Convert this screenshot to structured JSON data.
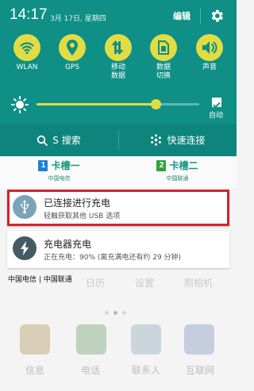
{
  "status_bar": {
    "time": "14:17",
    "date": "3月 17日, 星期四",
    "edit_label": "编辑",
    "settings_icon": "gear-icon"
  },
  "quick_settings": [
    {
      "label": "WLAN",
      "icon": "wifi-icon"
    },
    {
      "label": "GPS",
      "icon": "location-pin-icon"
    },
    {
      "label": "移动\n数据",
      "icon": "mobile-data-icon"
    },
    {
      "label": "数据\n切换",
      "icon": "sim-switch-icon"
    },
    {
      "label": "声音",
      "icon": "speaker-icon"
    }
  ],
  "brightness": {
    "level": 0.73,
    "auto_label": "自动",
    "auto_checked": true
  },
  "actions": {
    "search_label": "S 搜索",
    "quick_connect_label": "快速连接"
  },
  "sim": [
    {
      "number": "1",
      "name": "卡槽一",
      "carrier": "中国电信",
      "color": "#1f7fd6"
    },
    {
      "number": "2",
      "name": "卡槽二",
      "carrier": "中国联通",
      "color": "#2fa33c"
    }
  ],
  "notifications": [
    {
      "title": "已连接进行充电",
      "subtitle": "轻触获取其他 USB 选项",
      "icon": "usb-icon",
      "icon_color": "#7aa3b8"
    },
    {
      "title": "充电器充电",
      "subtitle": "正在充电：90% (离充满电还有约 29 分钟)",
      "icon": "lightning-icon",
      "icon_color": "#455a64"
    }
  ],
  "carrier_line": "中国电信 | 中国联通",
  "home_screen": {
    "app_labels": [
      "日历",
      "设置",
      "照相机"
    ],
    "dock_labels": [
      "信息",
      "电话",
      "联系人",
      "互联网"
    ]
  },
  "colors": {
    "panel": "#0f8f85",
    "accent": "#e2dc44",
    "highlight": "#d2242c",
    "sim_text": "#15997f"
  }
}
